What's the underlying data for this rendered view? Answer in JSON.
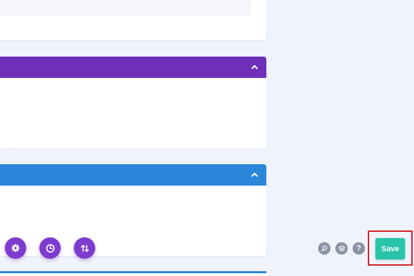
{
  "colors": {
    "page_background": "#f0f3fb",
    "card_background": "#ffffff",
    "purple_header": "#6f2fb8",
    "blue_header": "#2b87da",
    "action_button": "#7d3bcf",
    "tool_icon": "#8b94a6",
    "save_button": "#29c4a9",
    "highlight_frame": "#d61e24"
  },
  "panels": [
    {
      "name": "top-panel",
      "collapsed": false
    },
    {
      "name": "purple-panel",
      "header_color": "purple",
      "toggle_icon": "chevron-up-icon"
    },
    {
      "name": "blue-panel",
      "header_color": "blue",
      "toggle_icon": "chevron-up-icon"
    }
  ],
  "action_buttons": [
    {
      "icon": "gear-icon"
    },
    {
      "icon": "history-clock-icon"
    },
    {
      "icon": "sort-arrows-icon"
    }
  ],
  "toolbar": {
    "icons": [
      "search-zoom-icon",
      "layers-icon",
      "help-icon"
    ],
    "help_glyph": "?",
    "save_label": "Save"
  }
}
